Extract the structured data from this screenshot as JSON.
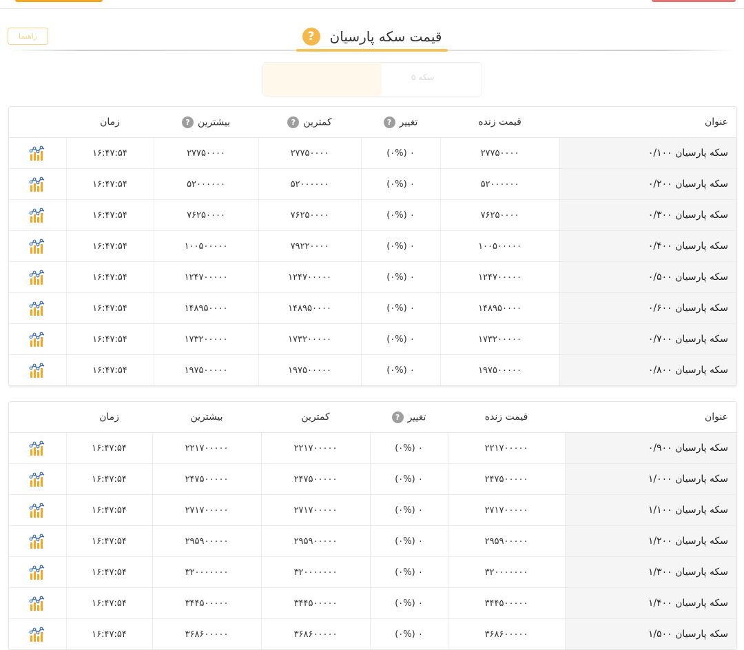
{
  "page": {
    "title": "قیمت سکه پارسیان",
    "help_symbol": "?",
    "guide_button": "راهنما",
    "faded_tab_label": "سکه ۵"
  },
  "columns": {
    "title": "عنوان",
    "live_price": "قیمت زنده",
    "change": "تغییر",
    "min": "کمترین",
    "max": "بیشترین",
    "time": "زمان"
  },
  "table1": {
    "rows": [
      {
        "title": "سکه پارسیان ۰/۱۰۰",
        "price": "۲۷۷۵۰۰۰۰",
        "change": "۰ (۰%)",
        "min": "۲۷۷۵۰۰۰۰",
        "max": "۲۷۷۵۰۰۰۰",
        "time": "۱۶:۴۷:۵۴"
      },
      {
        "title": "سکه پارسیان ۰/۲۰۰",
        "price": "۵۲۰۰۰۰۰۰",
        "change": "۰ (۰%)",
        "min": "۵۲۰۰۰۰۰۰",
        "max": "۵۲۰۰۰۰۰۰",
        "time": "۱۶:۴۷:۵۴"
      },
      {
        "title": "سکه پارسیان ۰/۳۰۰",
        "price": "۷۶۲۵۰۰۰۰",
        "change": "۰ (۰%)",
        "min": "۷۶۲۵۰۰۰۰",
        "max": "۷۶۲۵۰۰۰۰",
        "time": "۱۶:۴۷:۵۴"
      },
      {
        "title": "سکه پارسیان ۰/۴۰۰",
        "price": "۱۰۰۵۰۰۰۰۰",
        "change": "۰ (۰%)",
        "min": "۷۹۲۲۰۰۰۰",
        "max": "۱۰۰۵۰۰۰۰۰",
        "time": "۱۶:۴۷:۵۴"
      },
      {
        "title": "سکه پارسیان ۰/۵۰۰",
        "price": "۱۲۴۷۰۰۰۰۰",
        "change": "۰ (۰%)",
        "min": "۱۲۴۷۰۰۰۰۰",
        "max": "۱۲۴۷۰۰۰۰۰",
        "time": "۱۶:۴۷:۵۴"
      },
      {
        "title": "سکه پارسیان ۰/۶۰۰",
        "price": "۱۴۸۹۵۰۰۰۰",
        "change": "۰ (۰%)",
        "min": "۱۴۸۹۵۰۰۰۰",
        "max": "۱۴۸۹۵۰۰۰۰",
        "time": "۱۶:۴۷:۵۴"
      },
      {
        "title": "سکه پارسیان ۰/۷۰۰",
        "price": "۱۷۳۲۰۰۰۰۰",
        "change": "۰ (۰%)",
        "min": "۱۷۳۲۰۰۰۰۰",
        "max": "۱۷۳۲۰۰۰۰۰",
        "time": "۱۶:۴۷:۵۴"
      },
      {
        "title": "سکه پارسیان ۰/۸۰۰",
        "price": "۱۹۷۵۰۰۰۰۰",
        "change": "۰ (۰%)",
        "min": "۱۹۷۵۰۰۰۰۰",
        "max": "۱۹۷۵۰۰۰۰۰",
        "time": "۱۶:۴۷:۵۴"
      }
    ]
  },
  "table2": {
    "rows": [
      {
        "title": "سکه پارسیان ۰/۹۰۰",
        "price": "۲۲۱۷۰۰۰۰۰",
        "change": "۰ (۰%)",
        "min": "۲۲۱۷۰۰۰۰۰",
        "max": "۲۲۱۷۰۰۰۰۰",
        "time": "۱۶:۴۷:۵۴"
      },
      {
        "title": "سکه پارسیان ۱/۰۰۰",
        "price": "۲۴۷۵۰۰۰۰۰",
        "change": "۰ (۰%)",
        "min": "۲۴۷۵۰۰۰۰۰",
        "max": "۲۴۷۵۰۰۰۰۰",
        "time": "۱۶:۴۷:۵۴"
      },
      {
        "title": "سکه پارسیان ۱/۱۰۰",
        "price": "۲۷۱۷۰۰۰۰۰",
        "change": "۰ (۰%)",
        "min": "۲۷۱۷۰۰۰۰۰",
        "max": "۲۷۱۷۰۰۰۰۰",
        "time": "۱۶:۴۷:۵۴"
      },
      {
        "title": "سکه پارسیان ۱/۲۰۰",
        "price": "۲۹۵۹۰۰۰۰۰",
        "change": "۰ (۰%)",
        "min": "۲۹۵۹۰۰۰۰۰",
        "max": "۲۹۵۹۰۰۰۰۰",
        "time": "۱۶:۴۷:۵۴"
      },
      {
        "title": "سکه پارسیان ۱/۳۰۰",
        "price": "۳۲۰۰۰۰۰۰۰",
        "change": "۰ (۰%)",
        "min": "۳۲۰۰۰۰۰۰۰",
        "max": "۳۲۰۰۰۰۰۰۰",
        "time": "۱۶:۴۷:۵۴"
      },
      {
        "title": "سکه پارسیان ۱/۴۰۰",
        "price": "۳۴۴۵۰۰۰۰۰",
        "change": "۰ (۰%)",
        "min": "۳۴۴۵۰۰۰۰۰",
        "max": "۳۴۴۵۰۰۰۰۰",
        "time": "۱۶:۴۷:۵۴"
      },
      {
        "title": "سکه پارسیان ۱/۵۰۰",
        "price": "۳۶۸۶۰۰۰۰۰",
        "change": "۰ (۰%)",
        "min": "۳۶۸۶۰۰۰۰۰",
        "max": "۳۶۸۶۰۰۰۰۰",
        "time": "۱۶:۴۷:۵۴"
      }
    ]
  },
  "icons": {
    "chart": "chart-icon",
    "help": "help-icon"
  },
  "colors": {
    "accent": "#f5b84a",
    "chart_orange": "#f5a623",
    "chart_blue": "#3f6fb5",
    "help_grey": "#9e9e9e"
  }
}
